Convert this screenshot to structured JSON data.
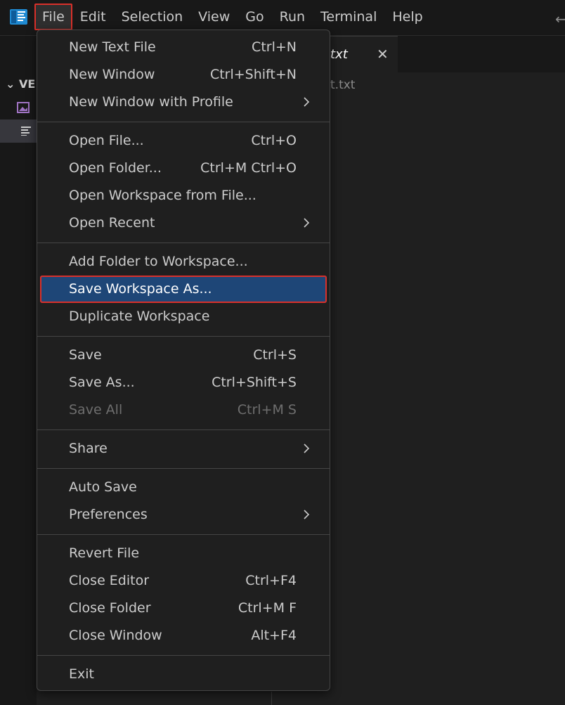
{
  "menubar": {
    "items": [
      "File",
      "Edit",
      "Selection",
      "View",
      "Go",
      "Run",
      "Terminal",
      "Help"
    ],
    "active": "File"
  },
  "editor": {
    "tab_label": "txt",
    "breadcrumb": "t.txt",
    "explorer_header": "VE"
  },
  "file_menu": {
    "items": [
      {
        "label": "New Text File",
        "shortcut": "Ctrl+N"
      },
      {
        "label": "New Window",
        "shortcut": "Ctrl+Shift+N"
      },
      {
        "label": "New Window with Profile",
        "submenu": true
      },
      {
        "label": "Open File...",
        "shortcut": "Ctrl+O"
      },
      {
        "label": "Open Folder...",
        "shortcut": "Ctrl+M Ctrl+O"
      },
      {
        "label": "Open Workspace from File..."
      },
      {
        "label": "Open Recent",
        "submenu": true
      },
      {
        "label": "Add Folder to Workspace..."
      },
      {
        "label": "Save Workspace As...",
        "selected": true
      },
      {
        "label": "Duplicate Workspace"
      },
      {
        "label": "Save",
        "shortcut": "Ctrl+S"
      },
      {
        "label": "Save As...",
        "shortcut": "Ctrl+Shift+S"
      },
      {
        "label": "Save All",
        "shortcut": "Ctrl+M S",
        "disabled": true
      },
      {
        "label": "Share",
        "submenu": true
      },
      {
        "label": "Auto Save"
      },
      {
        "label": "Preferences",
        "submenu": true
      },
      {
        "label": "Revert File"
      },
      {
        "label": "Close Editor",
        "shortcut": "Ctrl+F4"
      },
      {
        "label": "Close Folder",
        "shortcut": "Ctrl+M F"
      },
      {
        "label": "Close Window",
        "shortcut": "Alt+F4"
      },
      {
        "label": "Exit"
      }
    ]
  },
  "colors": {
    "selected_bg": "#1e4677",
    "highlight_outline": "#d9302a",
    "menu_bg": "#1f1f1f"
  }
}
